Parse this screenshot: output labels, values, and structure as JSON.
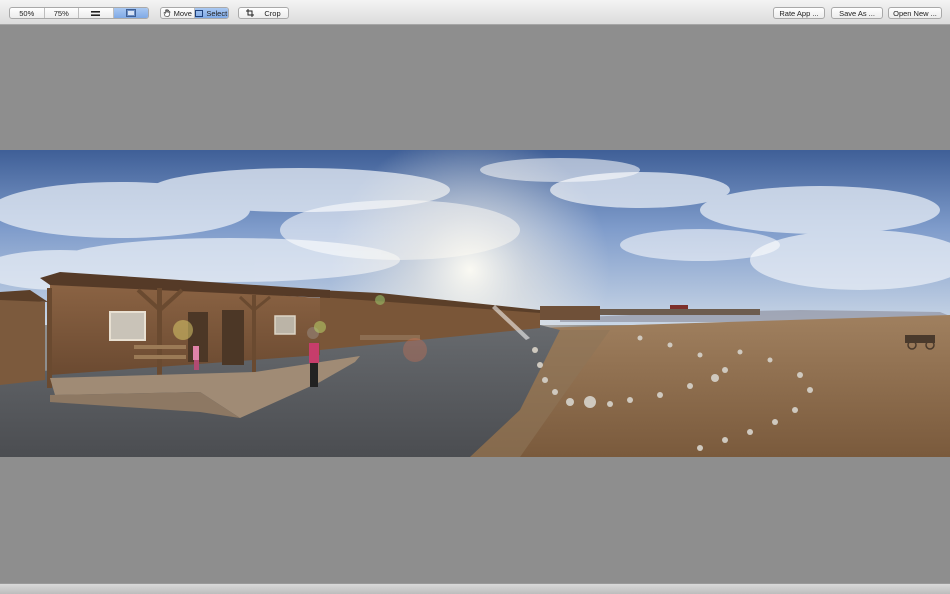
{
  "toolbar": {
    "zoom_options": [
      {
        "label": "50%",
        "icon": null,
        "active": false
      },
      {
        "label": "75%",
        "icon": null,
        "active": false
      },
      {
        "label": "",
        "icon": "fit-equals-icon",
        "active": false
      },
      {
        "label": "",
        "icon": "fit-image-icon",
        "active": true
      }
    ],
    "tools": [
      {
        "label": "Move",
        "icon": "hand-icon",
        "active": false
      },
      {
        "label": "Select",
        "icon": "select-icon",
        "active": true
      }
    ],
    "crop_label": "Crop",
    "rate_label": "Rate App ...",
    "save_label": "Save As ...",
    "open_label": "Open New ..."
  },
  "colors": {
    "canvas_bg": "#8e8e8e",
    "active_segment": "#8fb4ea",
    "toolbar_bg": "#e6e6e6"
  }
}
